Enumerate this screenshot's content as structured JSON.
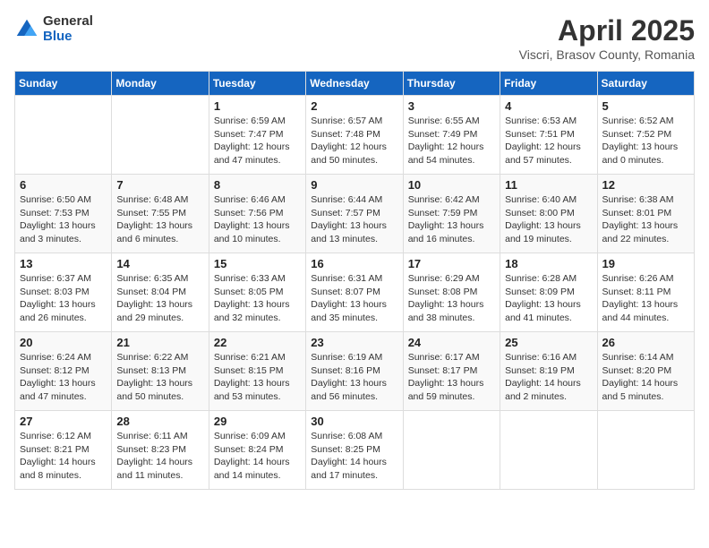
{
  "logo": {
    "general": "General",
    "blue": "Blue"
  },
  "title": "April 2025",
  "subtitle": "Viscri, Brasov County, Romania",
  "days_header": [
    "Sunday",
    "Monday",
    "Tuesday",
    "Wednesday",
    "Thursday",
    "Friday",
    "Saturday"
  ],
  "weeks": [
    [
      {
        "day": "",
        "detail": ""
      },
      {
        "day": "",
        "detail": ""
      },
      {
        "day": "1",
        "detail": "Sunrise: 6:59 AM\nSunset: 7:47 PM\nDaylight: 12 hours and 47 minutes."
      },
      {
        "day": "2",
        "detail": "Sunrise: 6:57 AM\nSunset: 7:48 PM\nDaylight: 12 hours and 50 minutes."
      },
      {
        "day": "3",
        "detail": "Sunrise: 6:55 AM\nSunset: 7:49 PM\nDaylight: 12 hours and 54 minutes."
      },
      {
        "day": "4",
        "detail": "Sunrise: 6:53 AM\nSunset: 7:51 PM\nDaylight: 12 hours and 57 minutes."
      },
      {
        "day": "5",
        "detail": "Sunrise: 6:52 AM\nSunset: 7:52 PM\nDaylight: 13 hours and 0 minutes."
      }
    ],
    [
      {
        "day": "6",
        "detail": "Sunrise: 6:50 AM\nSunset: 7:53 PM\nDaylight: 13 hours and 3 minutes."
      },
      {
        "day": "7",
        "detail": "Sunrise: 6:48 AM\nSunset: 7:55 PM\nDaylight: 13 hours and 6 minutes."
      },
      {
        "day": "8",
        "detail": "Sunrise: 6:46 AM\nSunset: 7:56 PM\nDaylight: 13 hours and 10 minutes."
      },
      {
        "day": "9",
        "detail": "Sunrise: 6:44 AM\nSunset: 7:57 PM\nDaylight: 13 hours and 13 minutes."
      },
      {
        "day": "10",
        "detail": "Sunrise: 6:42 AM\nSunset: 7:59 PM\nDaylight: 13 hours and 16 minutes."
      },
      {
        "day": "11",
        "detail": "Sunrise: 6:40 AM\nSunset: 8:00 PM\nDaylight: 13 hours and 19 minutes."
      },
      {
        "day": "12",
        "detail": "Sunrise: 6:38 AM\nSunset: 8:01 PM\nDaylight: 13 hours and 22 minutes."
      }
    ],
    [
      {
        "day": "13",
        "detail": "Sunrise: 6:37 AM\nSunset: 8:03 PM\nDaylight: 13 hours and 26 minutes."
      },
      {
        "day": "14",
        "detail": "Sunrise: 6:35 AM\nSunset: 8:04 PM\nDaylight: 13 hours and 29 minutes."
      },
      {
        "day": "15",
        "detail": "Sunrise: 6:33 AM\nSunset: 8:05 PM\nDaylight: 13 hours and 32 minutes."
      },
      {
        "day": "16",
        "detail": "Sunrise: 6:31 AM\nSunset: 8:07 PM\nDaylight: 13 hours and 35 minutes."
      },
      {
        "day": "17",
        "detail": "Sunrise: 6:29 AM\nSunset: 8:08 PM\nDaylight: 13 hours and 38 minutes."
      },
      {
        "day": "18",
        "detail": "Sunrise: 6:28 AM\nSunset: 8:09 PM\nDaylight: 13 hours and 41 minutes."
      },
      {
        "day": "19",
        "detail": "Sunrise: 6:26 AM\nSunset: 8:11 PM\nDaylight: 13 hours and 44 minutes."
      }
    ],
    [
      {
        "day": "20",
        "detail": "Sunrise: 6:24 AM\nSunset: 8:12 PM\nDaylight: 13 hours and 47 minutes."
      },
      {
        "day": "21",
        "detail": "Sunrise: 6:22 AM\nSunset: 8:13 PM\nDaylight: 13 hours and 50 minutes."
      },
      {
        "day": "22",
        "detail": "Sunrise: 6:21 AM\nSunset: 8:15 PM\nDaylight: 13 hours and 53 minutes."
      },
      {
        "day": "23",
        "detail": "Sunrise: 6:19 AM\nSunset: 8:16 PM\nDaylight: 13 hours and 56 minutes."
      },
      {
        "day": "24",
        "detail": "Sunrise: 6:17 AM\nSunset: 8:17 PM\nDaylight: 13 hours and 59 minutes."
      },
      {
        "day": "25",
        "detail": "Sunrise: 6:16 AM\nSunset: 8:19 PM\nDaylight: 14 hours and 2 minutes."
      },
      {
        "day": "26",
        "detail": "Sunrise: 6:14 AM\nSunset: 8:20 PM\nDaylight: 14 hours and 5 minutes."
      }
    ],
    [
      {
        "day": "27",
        "detail": "Sunrise: 6:12 AM\nSunset: 8:21 PM\nDaylight: 14 hours and 8 minutes."
      },
      {
        "day": "28",
        "detail": "Sunrise: 6:11 AM\nSunset: 8:23 PM\nDaylight: 14 hours and 11 minutes."
      },
      {
        "day": "29",
        "detail": "Sunrise: 6:09 AM\nSunset: 8:24 PM\nDaylight: 14 hours and 14 minutes."
      },
      {
        "day": "30",
        "detail": "Sunrise: 6:08 AM\nSunset: 8:25 PM\nDaylight: 14 hours and 17 minutes."
      },
      {
        "day": "",
        "detail": ""
      },
      {
        "day": "",
        "detail": ""
      },
      {
        "day": "",
        "detail": ""
      }
    ]
  ]
}
